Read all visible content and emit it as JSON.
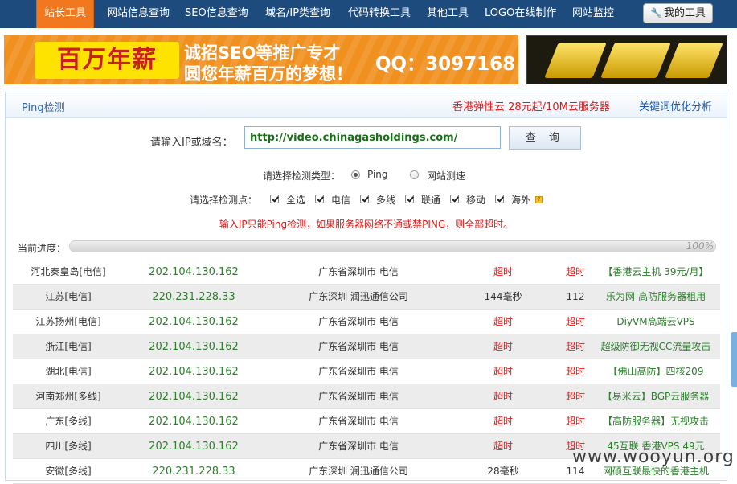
{
  "nav": {
    "items": [
      "站长工具",
      "网站信息查询",
      "SEO信息查询",
      "域名/IP类查询",
      "代码转换工具",
      "其他工具",
      "LOGO在线制作",
      "网站监控"
    ],
    "my_tools": "我的工具"
  },
  "banner": {
    "big": "百万年薪",
    "line1": "诚招SEO等推广专才",
    "line2": "圆您年薪百万的梦想！",
    "qq": "QQ：3097168"
  },
  "panel": {
    "title": "Ping检测",
    "ad_link1": "香港弹性云 28元起/10M云服务器",
    "ad_link2": "关键词优化分析"
  },
  "form": {
    "ip_label": "请输入IP或域名：",
    "ip_value": "http://video.chinagasholdings.com/",
    "query_button": "查 询",
    "type_label": "请选择检测类型：",
    "type_options": [
      "Ping",
      "网站测速"
    ],
    "type_selected": "Ping",
    "point_label": "请选择检测点：",
    "points": [
      "全选",
      "电信",
      "多线",
      "联通",
      "移动",
      "海外"
    ],
    "note": "输入IP只能Ping检测，如果服务器网络不通或禁PING，则全部超时。",
    "progress_label": "当前进度：",
    "progress_text": "100%",
    "progress_value": 1.0
  },
  "results": [
    {
      "node": "河北秦皇岛[电信]",
      "ip": "202.104.130.162",
      "location": "广东省深圳市 电信",
      "time": "超时",
      "ttl": "超时",
      "ad": "【香港云主机 39元/月】"
    },
    {
      "node": "江苏[电信]",
      "ip": "220.231.228.33",
      "location": "广东深圳 润迅通信公司",
      "time": "144毫秒",
      "ttl": "112",
      "ad": "乐为网-高防服务器租用"
    },
    {
      "node": "江苏扬州[电信]",
      "ip": "202.104.130.162",
      "location": "广东省深圳市 电信",
      "time": "超时",
      "ttl": "超时",
      "ad": "DiyVM高端云VPS"
    },
    {
      "node": "浙江[电信]",
      "ip": "202.104.130.162",
      "location": "广东省深圳市 电信",
      "time": "超时",
      "ttl": "超时",
      "ad": "超级防御无视CC流量攻击"
    },
    {
      "node": "湖北[电信]",
      "ip": "202.104.130.162",
      "location": "广东省深圳市 电信",
      "time": "超时",
      "ttl": "超时",
      "ad": "【佛山高防】四核209"
    },
    {
      "node": "河南郑州[多线]",
      "ip": "202.104.130.162",
      "location": "广东省深圳市 电信",
      "time": "超时",
      "ttl": "超时",
      "ad": "【易米云】BGP云服务器"
    },
    {
      "node": "广东[多线]",
      "ip": "202.104.130.162",
      "location": "广东省深圳市 电信",
      "time": "超时",
      "ttl": "超时",
      "ad": "【高防服务器】无视攻击"
    },
    {
      "node": "四川[多线]",
      "ip": "202.104.130.162",
      "location": "广东省深圳市 电信",
      "time": "超时",
      "ttl": "超时",
      "ad": "45互联 香港VPS 49元"
    },
    {
      "node": "安徽[多线]",
      "ip": "220.231.228.33",
      "location": "广东深圳 润迅通信公司",
      "time": "28毫秒",
      "ttl": "114",
      "ad": "网硕互联最快的香港主机"
    }
  ],
  "watermark": "www.wooyun.org",
  "colors": {
    "nav_bg": "#1e4b7e",
    "nav_active": "#f2781f",
    "ok_green": "#2d7d2d",
    "timeout_red": "#e01a1a"
  }
}
